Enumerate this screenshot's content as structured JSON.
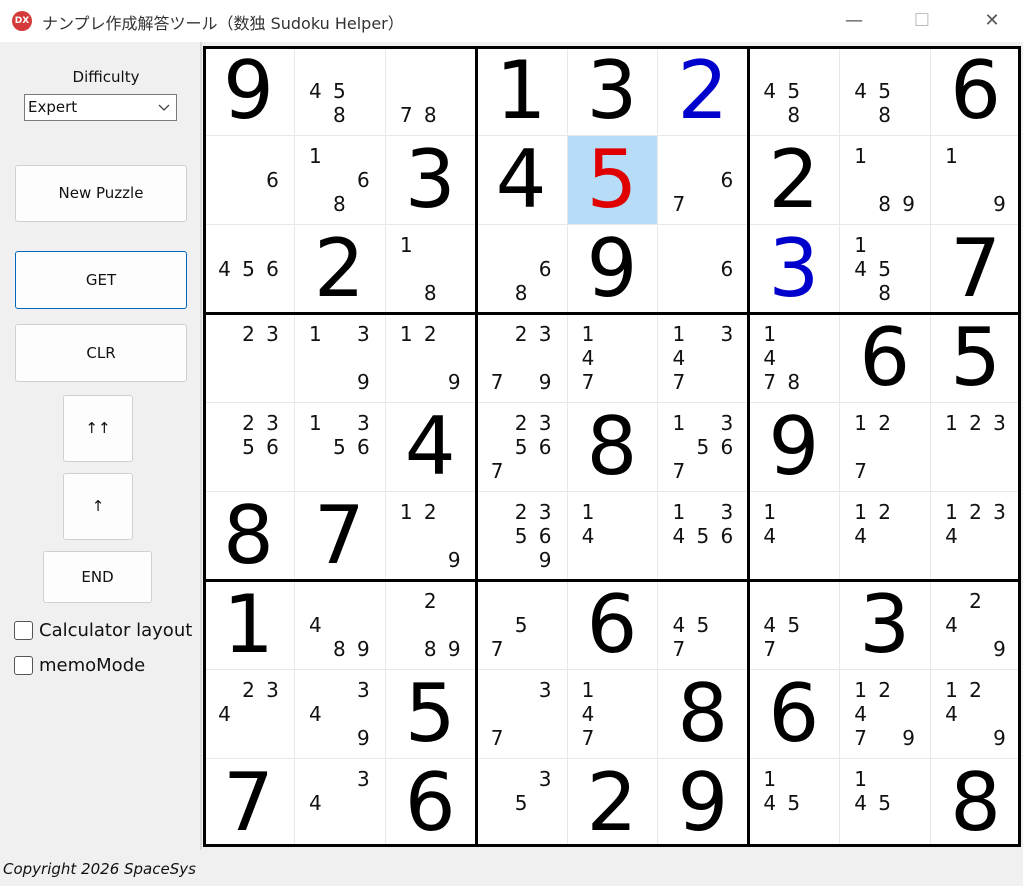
{
  "window": {
    "icon_text": "DX",
    "title": "ナンプレ作成解答ツール（数独 Sudoku Helper）",
    "minimize_glyph": "—",
    "maximize_glyph": "☐",
    "close_glyph": "✕"
  },
  "sidebar": {
    "difficulty_label": "Difficulty",
    "difficulty_value": "Expert",
    "new_puzzle": "New Puzzle",
    "get": "GET",
    "clr": "CLR",
    "double_up": "↑↑",
    "up": "↑",
    "end": "END",
    "calc_layout": "Calculator layout",
    "memo_mode": "memoMode"
  },
  "colors": {
    "given": "#000000",
    "entered": "#0000cc",
    "error": "#e00000",
    "selected_bg": "#b7dcf7"
  },
  "grid": [
    [
      {
        "v": "9"
      },
      {
        "m": "458"
      },
      {
        "m": "78"
      },
      {
        "v": "1"
      },
      {
        "v": "3"
      },
      {
        "v": "2",
        "c": "entered"
      },
      {
        "m": "458"
      },
      {
        "m": "458"
      },
      {
        "v": "6"
      }
    ],
    [
      {
        "m": "6"
      },
      {
        "m": "168"
      },
      {
        "v": "3"
      },
      {
        "v": "4"
      },
      {
        "v": "5",
        "c": "error",
        "sel": true
      },
      {
        "m": "67"
      },
      {
        "v": "2"
      },
      {
        "m": "189"
      },
      {
        "m": "19"
      }
    ],
    [
      {
        "m": "456"
      },
      {
        "v": "2"
      },
      {
        "m": "18"
      },
      {
        "m": "68"
      },
      {
        "v": "9"
      },
      {
        "m": "6"
      },
      {
        "v": "3",
        "c": "entered"
      },
      {
        "m": "1458"
      },
      {
        "v": "7"
      }
    ],
    [
      {
        "m": "23"
      },
      {
        "m": "139"
      },
      {
        "m": "129"
      },
      {
        "m": "2379"
      },
      {
        "m": "147"
      },
      {
        "m": "1347"
      },
      {
        "m": "1478"
      },
      {
        "v": "6"
      },
      {
        "v": "5"
      }
    ],
    [
      {
        "m": "2356"
      },
      {
        "m": "1356"
      },
      {
        "v": "4"
      },
      {
        "m": "23567"
      },
      {
        "v": "8"
      },
      {
        "m": "13567"
      },
      {
        "v": "9"
      },
      {
        "m": "127"
      },
      {
        "m": "123"
      }
    ],
    [
      {
        "v": "8"
      },
      {
        "v": "7"
      },
      {
        "m": "129"
      },
      {
        "m": "23569"
      },
      {
        "m": "14"
      },
      {
        "m": "13456"
      },
      {
        "m": "14"
      },
      {
        "m": "124"
      },
      {
        "m": "1234"
      }
    ],
    [
      {
        "v": "1"
      },
      {
        "m": "489"
      },
      {
        "m": "289"
      },
      {
        "m": "57"
      },
      {
        "v": "6"
      },
      {
        "m": "457"
      },
      {
        "m": "457"
      },
      {
        "v": "3"
      },
      {
        "m": "249"
      }
    ],
    [
      {
        "m": "234"
      },
      {
        "m": "349"
      },
      {
        "v": "5"
      },
      {
        "m": "37"
      },
      {
        "m": "147"
      },
      {
        "v": "8"
      },
      {
        "v": "6"
      },
      {
        "m": "12479"
      },
      {
        "m": "1249"
      }
    ],
    [
      {
        "v": "7"
      },
      {
        "m": "34"
      },
      {
        "v": "6"
      },
      {
        "m": "35"
      },
      {
        "v": "2"
      },
      {
        "v": "9"
      },
      {
        "m": "145"
      },
      {
        "m": "145"
      },
      {
        "v": "8"
      }
    ]
  ],
  "footer": {
    "copyright": "Copyright 2026 SpaceSys"
  }
}
